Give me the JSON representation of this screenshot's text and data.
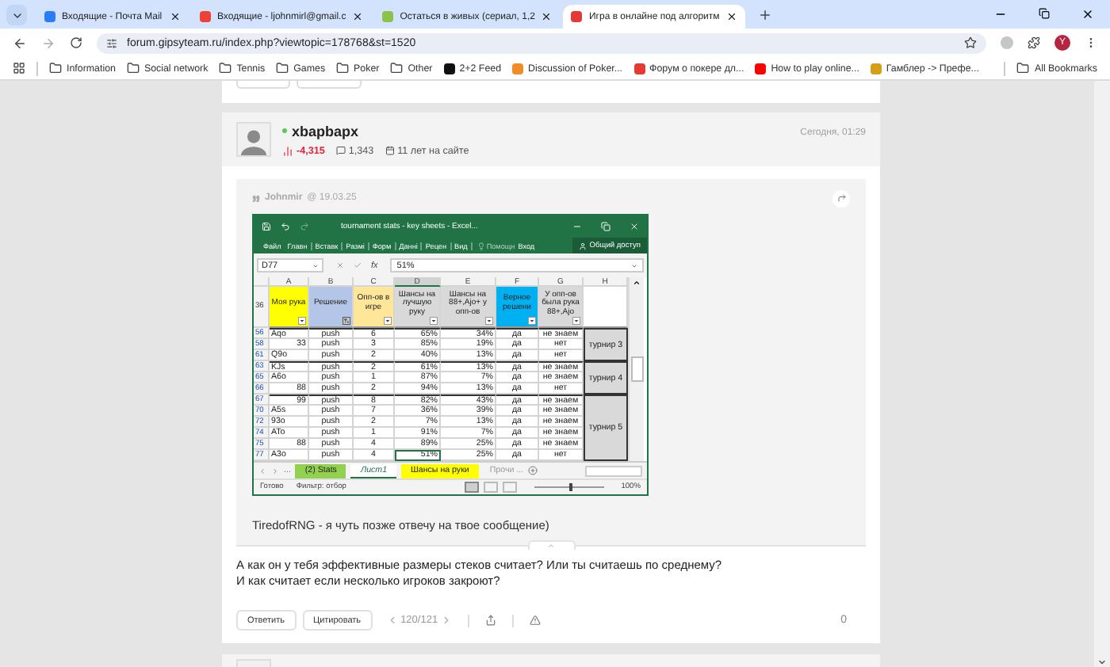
{
  "browser": {
    "tabs": [
      {
        "title": "Входящие - Почта Mail",
        "color": "#2c7cf6",
        "selected": false
      },
      {
        "title": "Входящие - ljohnmirl@gmail.c",
        "color": "#ea4335",
        "selected": false
      },
      {
        "title": "Остаться в живых (сериал, 1,2",
        "color": "#8bc34a",
        "selected": false
      },
      {
        "title": "Игра в онлайне под алгоритм",
        "color": "#e53935",
        "selected": true
      }
    ],
    "url": "forum.gipsyteam.ru/index.php?viewtopic=178768&st=1520",
    "profile_initial": "Y",
    "bookmarks": [
      {
        "label": "Information",
        "kind": "folder"
      },
      {
        "label": "Social network",
        "kind": "folder"
      },
      {
        "label": "Tennis",
        "kind": "folder"
      },
      {
        "label": "Games",
        "kind": "folder"
      },
      {
        "label": "Poker",
        "kind": "folder"
      },
      {
        "label": "Other",
        "kind": "folder"
      },
      {
        "label": "2+2 Feed",
        "kind": "site",
        "color": "#111111"
      },
      {
        "label": "Discussion of Poker...",
        "kind": "site",
        "color": "#f28c28"
      },
      {
        "label": "Форум о покере дл...",
        "kind": "site",
        "color": "#e53935"
      },
      {
        "label": "How to play online...",
        "kind": "site",
        "color": "#ff0000"
      },
      {
        "label": "Гамблер -> Префе...",
        "kind": "site",
        "color": "#d4a017"
      }
    ],
    "all_bookmarks": "All Bookmarks"
  },
  "post": {
    "author": "xbapbapx",
    "online": true,
    "rating": "-4,315",
    "messages": "1,343",
    "tenure": "11 лет на сайте",
    "date": "Сегодня, 01:29",
    "quote": {
      "author": "Johnmir",
      "date": "@ 19.03.25",
      "text": "TiredofRNG - я чуть позже отвечу на твое сообщение)"
    },
    "text": [
      "А как он у тебя эффективные размеры стеков считает? Или ты считаешь по среднему?",
      "И как считает если несколько игроков закроют?"
    ],
    "actions": [
      "Ответить",
      "Цитировать"
    ],
    "page": "120/121",
    "likes": "0"
  },
  "excel": {
    "title": "tournament stats - key sheets - Excel...",
    "ribbon_tabs": [
      "Файл",
      "Главн",
      "Вставк",
      "Размі",
      "Форм",
      "Данні",
      "Рецен",
      "Вид"
    ],
    "help": "Помощн",
    "sign_in": "Вход",
    "share": "Общий доступ",
    "name_box": "D77",
    "function_label": "fx",
    "formula": "51%",
    "header_row": "36",
    "columns": [
      {
        "letter": "A",
        "title": "Моя рука",
        "color": "#ffff00",
        "has_filter": true,
        "filtered": false,
        "selected": false
      },
      {
        "letter": "B",
        "title": "Решение",
        "color": "#b4c6e7",
        "has_filter": true,
        "filtered": true,
        "selected": false
      },
      {
        "letter": "C",
        "title": "Опп-ов в игре",
        "color": "#ffe699",
        "has_filter": true,
        "filtered": false,
        "selected": false
      },
      {
        "letter": "D",
        "title": "Шансы на лучшую руку",
        "color": "#d9d9d9",
        "has_filter": true,
        "filtered": false,
        "selected": true
      },
      {
        "letter": "E",
        "title": "Шансы на 88+,Ajo+ у опп-ов",
        "color": "#d9d9d9",
        "has_filter": true,
        "filtered": false,
        "selected": false
      },
      {
        "letter": "F",
        "title": "Верное решени",
        "color": "#00b0f0",
        "has_filter": true,
        "filtered": false,
        "selected": false
      },
      {
        "letter": "G",
        "title": "У опп-ов была рука 88+,Ajo",
        "color": "#d9d9d9",
        "has_filter": true,
        "filtered": false,
        "selected": false
      },
      {
        "letter": "H",
        "has_filter": false,
        "selected": false
      }
    ],
    "groups": [
      {
        "label": "турнир 3",
        "rows": [
          {
            "num": "56",
            "numeric": false,
            "cells": [
              "Aqo",
              "push",
              "6",
              "65%",
              "34%",
              "да",
              "не знаем"
            ],
            "selected": false
          },
          {
            "num": "58",
            "numeric": true,
            "cells": [
              "33",
              "push",
              "3",
              "85%",
              "19%",
              "да",
              "нет"
            ],
            "selected": false
          },
          {
            "num": "61",
            "numeric": false,
            "cells": [
              "Q9o",
              "push",
              "2",
              "40%",
              "13%",
              "да",
              "нет"
            ],
            "selected": false
          }
        ]
      },
      {
        "label": "турнир 4",
        "rows": [
          {
            "num": "63",
            "numeric": false,
            "cells": [
              "KJs",
              "push",
              "2",
              "61%",
              "13%",
              "да",
              "не знаем"
            ],
            "selected": false
          },
          {
            "num": "65",
            "numeric": false,
            "cells": [
              "A6o",
              "push",
              "1",
              "87%",
              "7%",
              "да",
              "не знаем"
            ],
            "selected": false
          },
          {
            "num": "66",
            "numeric": true,
            "cells": [
              "88",
              "push",
              "2",
              "94%",
              "13%",
              "да",
              "нет"
            ],
            "selected": false
          }
        ]
      },
      {
        "label": "турнир 5",
        "rows": [
          {
            "num": "67",
            "numeric": true,
            "cells": [
              "99",
              "push",
              "8",
              "82%",
              "43%",
              "да",
              "не знаем"
            ],
            "selected": false
          },
          {
            "num": "70",
            "numeric": false,
            "cells": [
              "A5s",
              "push",
              "7",
              "36%",
              "39%",
              "да",
              "не знаем"
            ],
            "selected": false
          },
          {
            "num": "72",
            "numeric": false,
            "cells": [
              "93o",
              "push",
              "2",
              "7%",
              "13%",
              "да",
              "не знаем"
            ],
            "selected": false
          },
          {
            "num": "74",
            "numeric": false,
            "cells": [
              "ATo",
              "push",
              "1",
              "91%",
              "7%",
              "да",
              "не знаем"
            ],
            "selected": false
          },
          {
            "num": "75",
            "numeric": true,
            "cells": [
              "88",
              "push",
              "4",
              "89%",
              "25%",
              "да",
              "не знаем"
            ],
            "selected": false
          },
          {
            "num": "77",
            "numeric": false,
            "cells": [
              "A3o",
              "push",
              "4",
              "51%",
              "25%",
              "да",
              "нет"
            ],
            "selected": true
          }
        ]
      }
    ],
    "sheets": {
      "nav_more": "...",
      "tabs": [
        {
          "label": "(2) Stats",
          "color": "#92d050",
          "selected": false
        },
        {
          "label": "Лист1",
          "selected": true
        },
        {
          "label": "Шансы на руки",
          "color": "#ffff00",
          "selected": false
        }
      ],
      "more": "Прочи ..."
    },
    "status": {
      "ready": "Готово",
      "filter": "Фильтр: отбор",
      "views": [
        {
          "selected": true
        },
        {
          "selected": false
        },
        {
          "selected": false
        }
      ],
      "zoom": {
        "label": "100%",
        "level": 0.5
      }
    }
  }
}
